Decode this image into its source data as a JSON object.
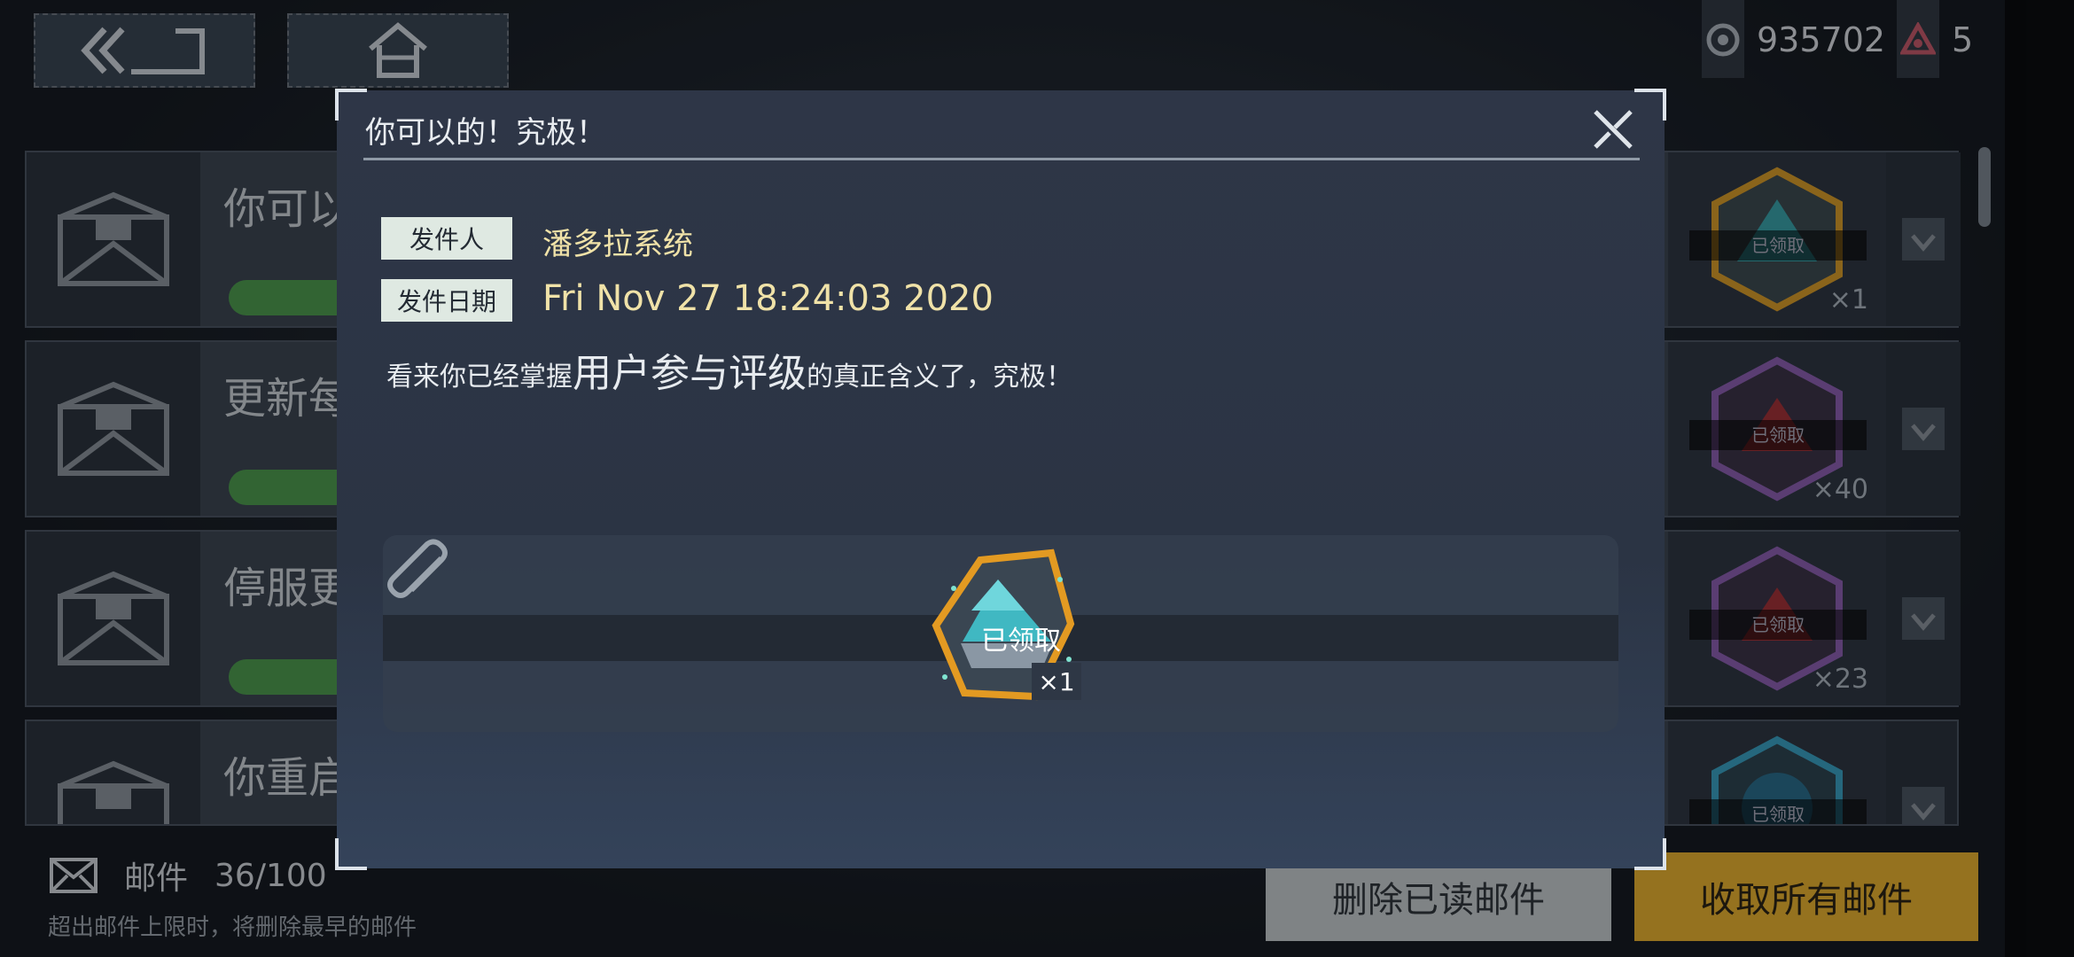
{
  "top_bar": {
    "back_icon": "back-arrow-icon",
    "home_icon": "home-icon",
    "currency1_icon": "credit-icon",
    "currency1_value": "935702",
    "currency2_icon": "gem-icon",
    "currency2_value": "5"
  },
  "mail_list": [
    {
      "title": "你可以",
      "reward_status": "已领取",
      "reward_count": "×1"
    },
    {
      "title": "更新每",
      "reward_status": "已领取",
      "reward_count": "×40"
    },
    {
      "title": "停服更",
      "reward_status": "已领取",
      "reward_count": "×23"
    },
    {
      "title": "你重启",
      "reward_status": "已领取",
      "reward_count": ""
    }
  ],
  "footer": {
    "mail_label": "邮件",
    "mail_count": "36/100",
    "note": "超出邮件上限时，将删除最早的邮件",
    "delete_read_label": "删除已读邮件",
    "collect_all_label": "收取所有邮件"
  },
  "modal": {
    "title": "你可以的！究极！",
    "sender_tag": "发件人",
    "sender": "潘多拉系统",
    "date_tag": "发件日期",
    "date": "Fri Nov 27 18:24:03 2020",
    "body_pre": "看来你已经掌握",
    "body_emph": "用户参与评级",
    "body_post": "的真正含义了，究极！",
    "attachment": {
      "status": "已领取",
      "count": "×1"
    }
  },
  "colors": {
    "accent_gold": "#e5b030",
    "text_gold": "#f0e2a8"
  }
}
